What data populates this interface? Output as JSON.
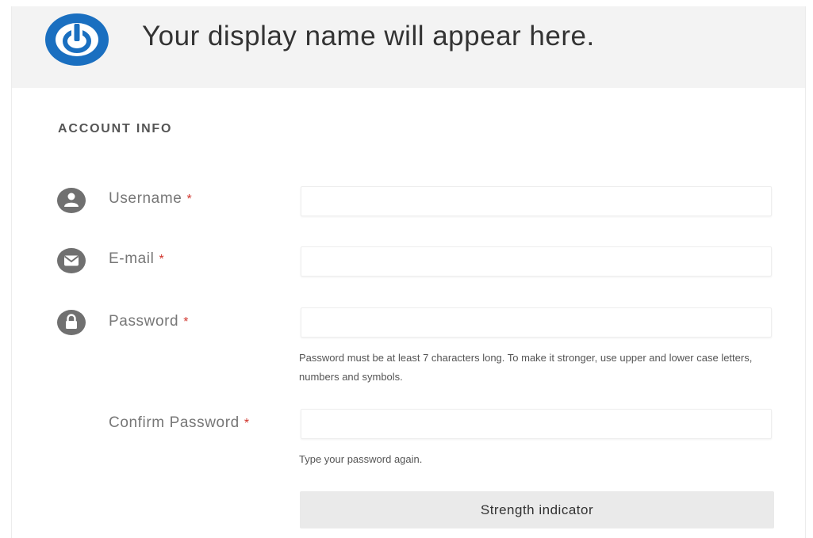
{
  "header": {
    "display_name": "Your display name will appear here.",
    "logo_icon": "power-icon",
    "logo_color": "#1a6fc0"
  },
  "section": {
    "title": "ACCOUNT INFO"
  },
  "fields": {
    "username": {
      "label": "Username",
      "required_mark": "*",
      "icon": "user-icon",
      "value": ""
    },
    "email": {
      "label": "E-mail",
      "required_mark": "*",
      "icon": "envelope-icon",
      "value": ""
    },
    "password": {
      "label": "Password",
      "required_mark": "*",
      "icon": "lock-icon",
      "value": "",
      "help": "Password must be at least 7 characters long. To make it stronger, use upper and lower case letters, numbers and symbols."
    },
    "confirm_password": {
      "label": "Confirm Password",
      "required_mark": "*",
      "value": "",
      "help": "Type your password again."
    }
  },
  "strength_indicator": {
    "label": "Strength indicator"
  },
  "colors": {
    "required": "#d0342c",
    "icon_gray": "#707070",
    "header_bg": "#f3f3f3"
  }
}
